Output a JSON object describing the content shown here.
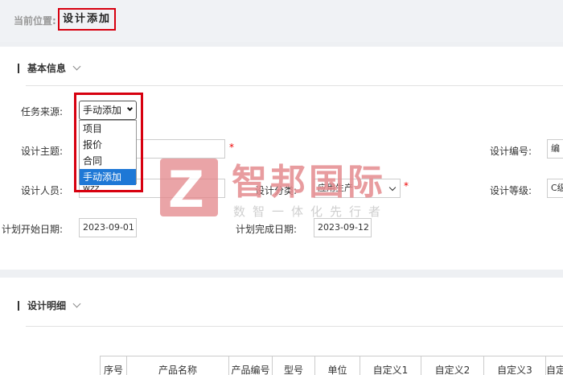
{
  "breadcrumb": {
    "label": "当前位置:",
    "current": "设计添加"
  },
  "basic_section": {
    "title": "基本信息"
  },
  "form": {
    "source_label": "任务来源:",
    "source_value": "手动添加",
    "source_options": [
      "项目",
      "报价",
      "合同",
      "手动添加"
    ],
    "subject_label": "设计主题:",
    "code_label": "设计编号:",
    "code_value": "编",
    "designer_label": "设计人员:",
    "designer_value": "wzz",
    "category_label": "设计分类:",
    "category_value": "应用生产",
    "grade_label": "设计等级:",
    "grade_value": "C级",
    "start_label": "计划开始日期:",
    "start_value": "2023-09-01",
    "end_label": "计划完成日期:",
    "end_value": "2023-09-12",
    "required_mark": "*"
  },
  "watermark": {
    "logo": "Z",
    "name": "智邦国际",
    "slogan": "数智一体化先行者"
  },
  "detail_section": {
    "title": "设计明细"
  },
  "table": {
    "columns": [
      "序号",
      "产品名称",
      "产品编号",
      "型号",
      "单位",
      "自定义1",
      "自定义2",
      "自定义3",
      "自定"
    ]
  }
}
